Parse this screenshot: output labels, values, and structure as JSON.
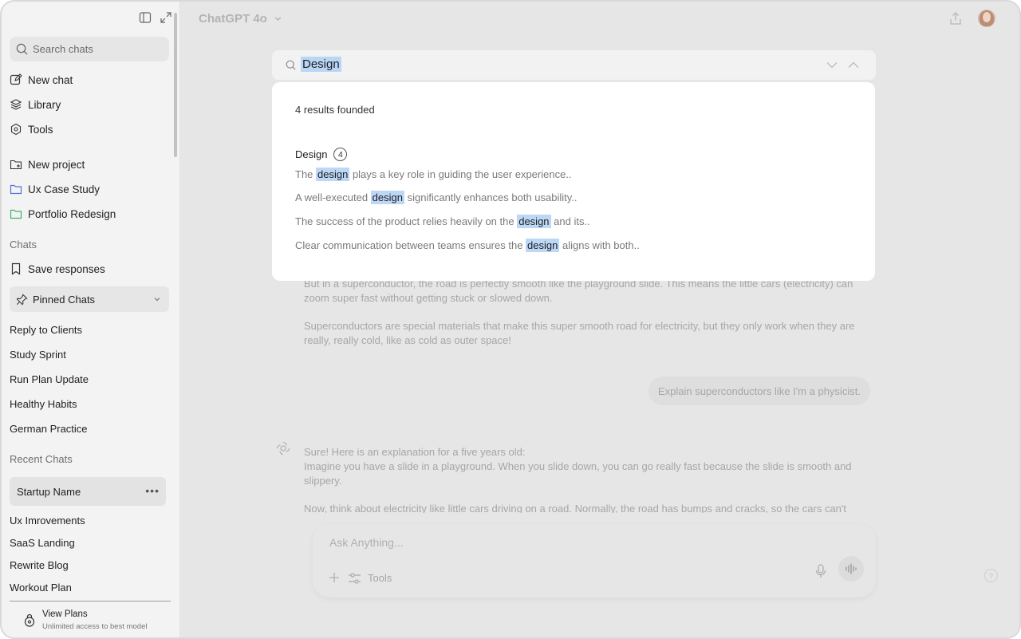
{
  "sidebar": {
    "search_placeholder": "Search chats",
    "new_chat": "New chat",
    "library": "Library",
    "tools": "Tools",
    "new_project": "New project",
    "projects": [
      "Ux Case Study",
      "Portfolio Redesign"
    ],
    "chats_section": "Chats",
    "save_responses": "Save responses",
    "pinned_chats": "Pinned Chats",
    "pinned": [
      "Reply to Clients",
      "Study Sprint",
      "Run Plan Update",
      "Healthy Habits",
      "German Practice"
    ],
    "recent_section": "Recent Chats",
    "active_chat": "Startup Name",
    "active_chat_menu": "•••",
    "recent": [
      "Ux Imrovements",
      "SaaS Landing",
      "Rewrite Blog",
      "Workout Plan"
    ],
    "plans_title": "View Plans",
    "plans_sub": "Unlimited access to best model"
  },
  "header": {
    "model": "ChatGPT 4o"
  },
  "conversation": {
    "p1_line1": "But in a superconductor, the road is perfectly smooth like the playground slide. This means the little cars (electricity) can",
    "p1_line2": "zoom super fast without getting stuck or slowed down.",
    "p2_line1": "Superconductors are special materials that make this super smooth road for electricity, but they only work when they are",
    "p2_line2": "really, really cold, like as cold as outer space!",
    "user_msg": "Explain superconductors like I'm a physicist.",
    "r_line1": "Sure! Here is an explanation for a five years old:",
    "r_line2": "Imagine you have a slide in a playground. When you slide down, you can go really fast because the slide is smooth and",
    "r_line3": "slippery.",
    "r_line4": "Now, think about electricity like little cars driving on a road. Normally, the road has bumps and cracks, so the cars can't"
  },
  "composer": {
    "placeholder": "Ask Anything...",
    "tools": "Tools",
    "help": "?"
  },
  "find": {
    "query": "Design",
    "count_text": "4 results founded",
    "group_label": "Design",
    "group_count": "4",
    "results": [
      {
        "before": "The ",
        "match": "design",
        "after": " plays a key role in guiding the user experience.."
      },
      {
        "before": "A well-executed ",
        "match": "design",
        "after": " significantly enhances both usability.."
      },
      {
        "before": "The success of the product relies heavily on the ",
        "match": "design",
        "after": " and its.."
      },
      {
        "before": "Clear communication between teams ensures the ",
        "match": "design",
        "after": " aligns with both.."
      }
    ]
  },
  "colors": {
    "highlight": "#bcd8f6",
    "sidebar_bg": "#f3f3f3",
    "main_bg": "#e6e6e6"
  }
}
